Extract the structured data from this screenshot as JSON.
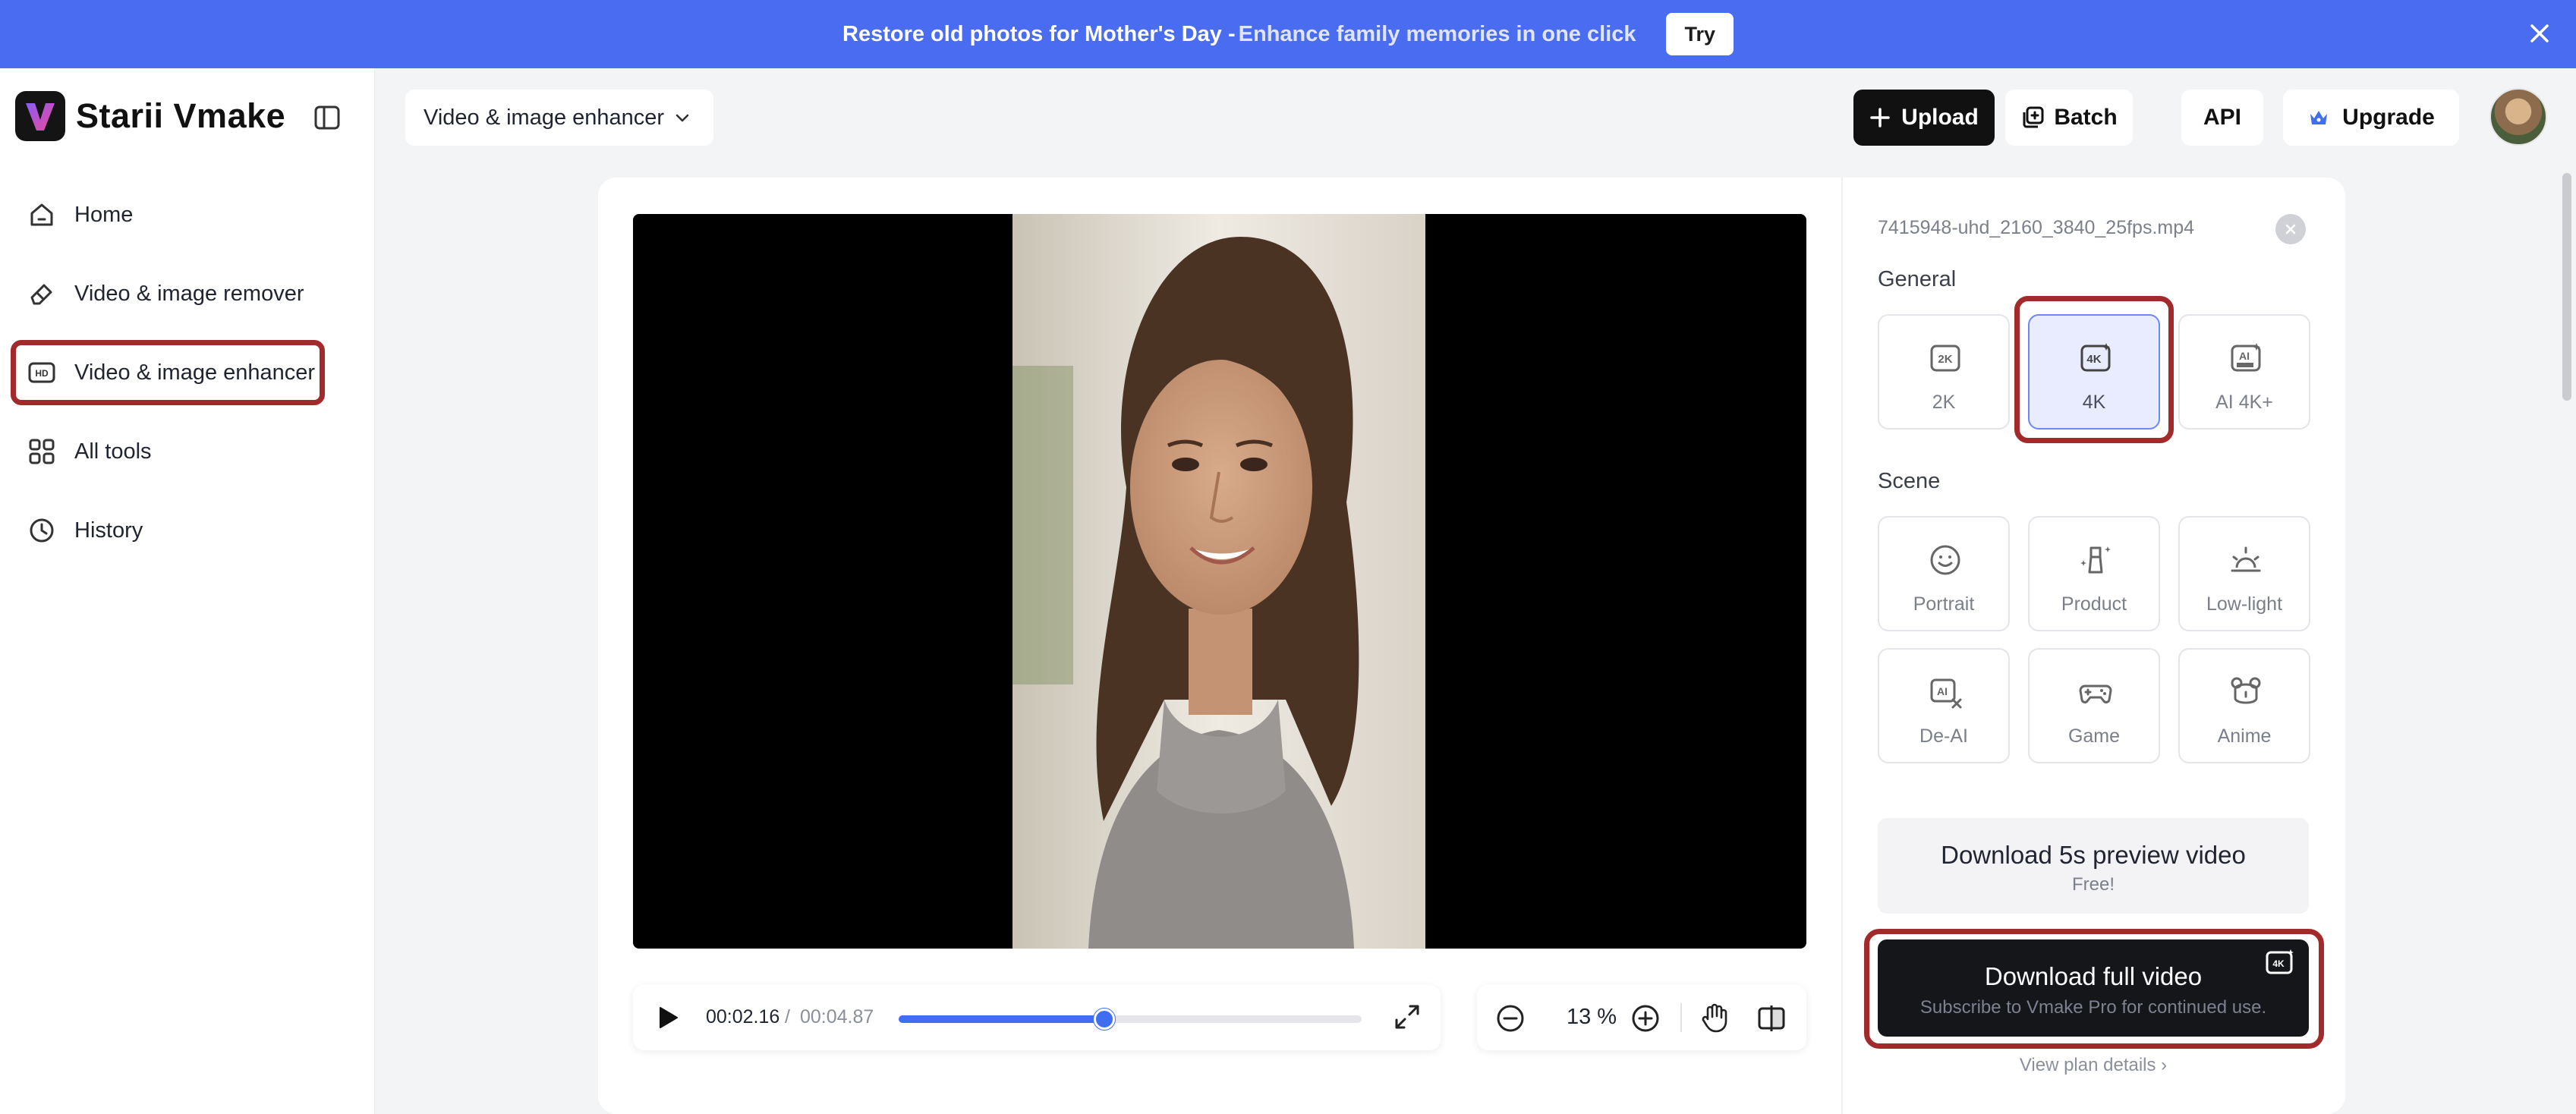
{
  "banner": {
    "text": "Restore old photos for Mother's Day -",
    "subtext": "Enhance family memories in one click",
    "try_label": "Try"
  },
  "app": {
    "name": "Starii Vmake"
  },
  "sidebar": {
    "items": [
      {
        "label": "Home",
        "icon": "home-icon"
      },
      {
        "label": "Video & image remover",
        "icon": "eraser-icon"
      },
      {
        "label": "Video & image enhancer",
        "icon": "hd-icon",
        "active": true
      },
      {
        "label": "All tools",
        "icon": "grid-icon"
      },
      {
        "label": "History",
        "icon": "clock-icon"
      }
    ]
  },
  "header": {
    "tool_select": "Video & image enhancer",
    "upload_label": "Upload",
    "batch_label": "Batch",
    "api_label": "API",
    "upgrade_label": "Upgrade"
  },
  "player": {
    "current_time": "00:02.16",
    "separator": "/",
    "total_time": "00:04.87",
    "progress": 0.444,
    "zoom": "13 %"
  },
  "panel": {
    "file_name": "7415948-uhd_2160_3840_25fps.mp4",
    "general_label": "General",
    "general_options": [
      {
        "label": "2K",
        "icon": "2k-icon"
      },
      {
        "label": "4K",
        "icon": "4k-icon",
        "selected": true
      },
      {
        "label": "AI 4K+",
        "icon": "ai-ultra-icon"
      }
    ],
    "scene_label": "Scene",
    "scene_options": [
      {
        "label": "Portrait",
        "icon": "smile-icon"
      },
      {
        "label": "Product",
        "icon": "product-icon"
      },
      {
        "label": "Low-light",
        "icon": "sunrise-icon"
      },
      {
        "label": "De-AI",
        "icon": "de-ai-icon"
      },
      {
        "label": "Game",
        "icon": "gamepad-icon"
      },
      {
        "label": "Anime",
        "icon": "bear-icon"
      }
    ],
    "download_preview_title": "Download 5s preview video",
    "download_preview_sub": "Free!",
    "download_full_title": "Download full video",
    "download_full_sub": "Subscribe to Vmake Pro for continued use.",
    "plan_link": "View plan details ›"
  },
  "colors": {
    "banner": "#4a6cf0",
    "accent": "#3f6ff0",
    "highlight": "#a32a2a",
    "selected_bg": "#e9ecff"
  }
}
